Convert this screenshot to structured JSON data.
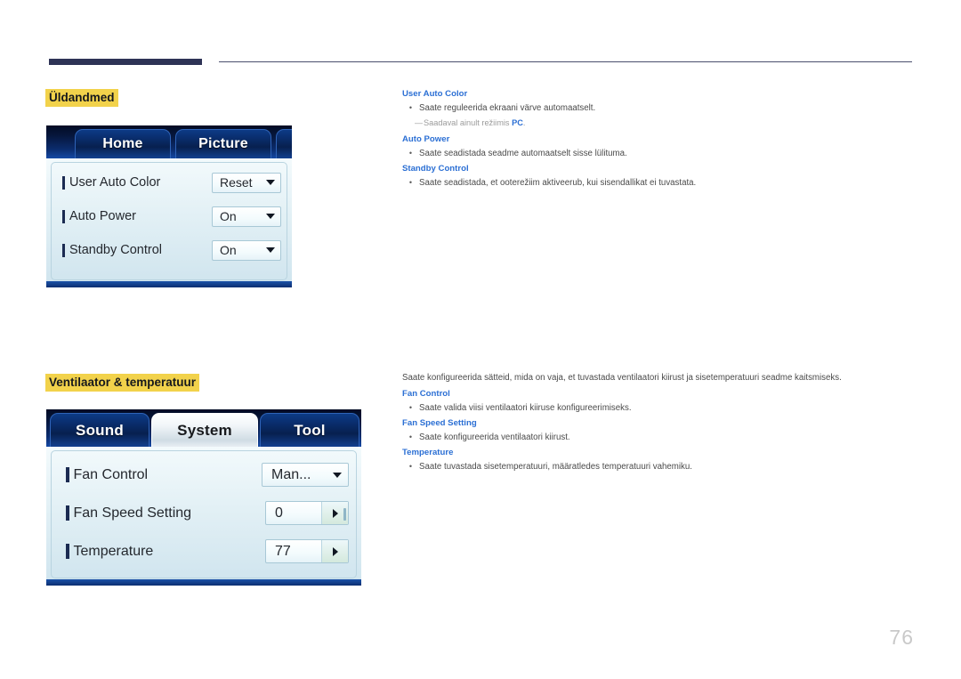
{
  "page": {
    "number": "76"
  },
  "sections": [
    {
      "heading": "Üldandmed",
      "osd": {
        "tabs": [
          {
            "label": "Home",
            "active": false
          },
          {
            "label": "Picture",
            "active": false
          }
        ],
        "rows": [
          {
            "label": "User Auto Color",
            "value": "Reset",
            "control": "dropdown"
          },
          {
            "label": "Auto Power",
            "value": "On",
            "control": "dropdown"
          },
          {
            "label": "Standby Control",
            "value": "On",
            "control": "dropdown"
          }
        ]
      },
      "intro": "",
      "items": [
        {
          "title": "User Auto Color",
          "bullets": [
            "Saate reguleerida ekraani värve automaatselt."
          ],
          "note": {
            "prefix": "Saadaval ainult režiimis ",
            "emphasis": "PC",
            "suffix": "."
          }
        },
        {
          "title": "Auto Power",
          "bullets": [
            "Saate seadistada seadme automaatselt sisse lülituma."
          ]
        },
        {
          "title": "Standby Control",
          "bullets": [
            "Saate seadistada, et ooterežiim aktiveerub, kui sisendallikat ei tuvastata."
          ]
        }
      ]
    },
    {
      "heading": "Ventilaator & temperatuur",
      "osd": {
        "tabs": [
          {
            "label": "Sound",
            "active": false
          },
          {
            "label": "System",
            "active": true
          },
          {
            "label": "Tool",
            "active": false
          }
        ],
        "rows": [
          {
            "label": "Fan Control",
            "value": "Man...",
            "control": "dropdown"
          },
          {
            "label": "Fan Speed Setting",
            "value": "0",
            "control": "stepper"
          },
          {
            "label": "Temperature",
            "value": "77",
            "control": "stepper"
          }
        ]
      },
      "intro": "Saate konfigureerida sätteid, mida on vaja, et tuvastada ventilaatori kiirust ja sisetemperatuuri seadme kaitsmiseks.",
      "items": [
        {
          "title": "Fan Control",
          "bullets": [
            "Saate valida viisi ventilaatori kiiruse konfigureerimiseks."
          ]
        },
        {
          "title": "Fan Speed Setting",
          "bullets": [
            "Saate konfigureerida ventilaatori kiirust."
          ]
        },
        {
          "title": "Temperature",
          "bullets": [
            "Saate tuvastada sisetemperatuuri, määratledes temperatuuri vahemiku."
          ]
        }
      ]
    }
  ],
  "colors": {
    "heading_highlight": "#f2d24b",
    "item_title": "#2b6fd4",
    "header_rule": "#2e3356",
    "page_number": "#c9c9c9"
  },
  "bullet_glyph": "•",
  "note_dash_glyph": "—"
}
